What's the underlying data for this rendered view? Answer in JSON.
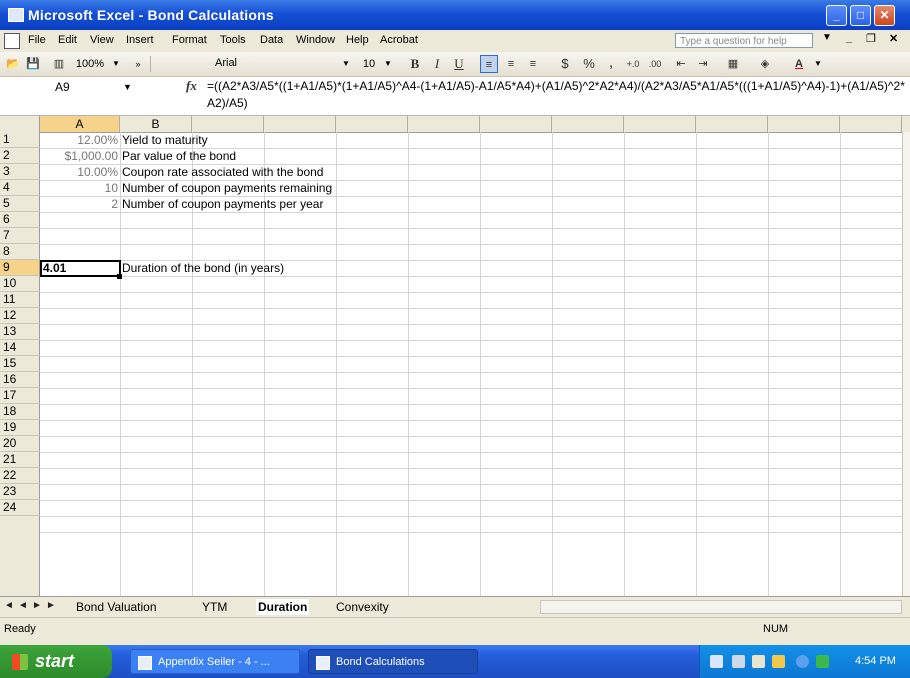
{
  "window": {
    "title": "Microsoft Excel - Bond Calculations"
  },
  "menu": [
    "File",
    "Edit",
    "View",
    "Insert",
    "Format",
    "Tools",
    "Data",
    "Window",
    "Help",
    "Acrobat"
  ],
  "help_placeholder": "Type a question for help",
  "toolbar": {
    "zoom": "100%",
    "font": "Arial",
    "font_size": "10"
  },
  "formula_bar": {
    "name_box": "A9",
    "fx": "fx",
    "formula": "=((A2*A3/A5*((1+A1/A5)*(1+A1/A5)^A4-(1+A1/A5)-A1/A5*A4)+(A1/A5)^2*A2*A4)/(A2*A3/A5*A1/A5*(((1+A1/A5)^A4)-1)+(A1/A5)^2*A2)/A5)"
  },
  "columns": [
    "A",
    "B"
  ],
  "rows": [
    "1",
    "2",
    "3",
    "4",
    "5",
    "6",
    "7",
    "8",
    "9",
    "10",
    "11",
    "12",
    "13",
    "14",
    "15",
    "16",
    "17",
    "18",
    "19",
    "20",
    "21",
    "22",
    "23",
    "24"
  ],
  "cells": {
    "a1": "12.00%",
    "b1": "Yield to maturity",
    "a2": "$1,000.00",
    "b2": "Par value of the bond",
    "a3": "10.00%",
    "b3": "Coupon rate associated with the bond",
    "a4": "10",
    "b4": "Number of coupon payments remaining",
    "a5": "2",
    "b5": "Number of coupon payments per year",
    "a9": "4.01",
    "b9": "Duration of the bond (in years)"
  },
  "sheet_tabs": [
    "Bond Valuation",
    "YTM",
    "Duration",
    "Convexity"
  ],
  "active_tab": "Duration",
  "status": {
    "text": "Ready",
    "num": "NUM"
  },
  "taskbar": {
    "start": "start",
    "items": [
      "Appendix Seiler - 4 - ...",
      "Bond Calculations"
    ],
    "clock": "4:54 PM"
  }
}
